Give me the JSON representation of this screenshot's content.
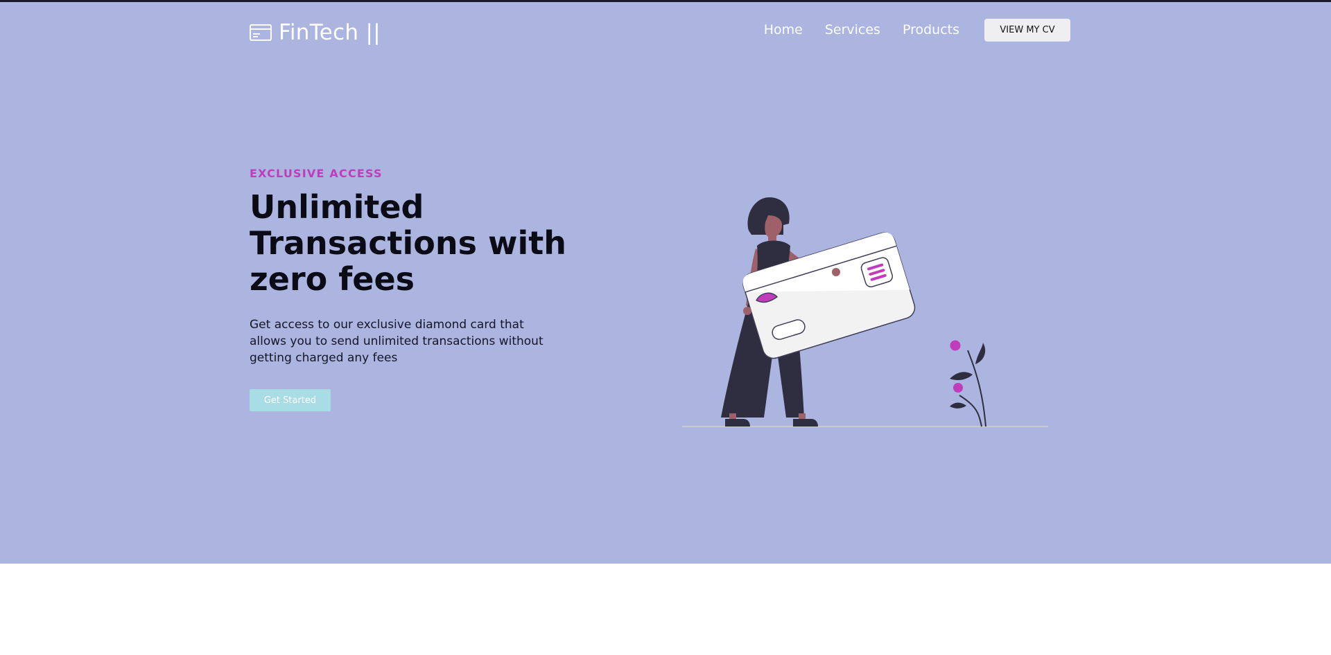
{
  "brand": {
    "name": "FinTech ||",
    "logo_icon": "credit-card-icon"
  },
  "nav": {
    "links": [
      "Home",
      "Services",
      "Products"
    ],
    "cv_button": "VIEW MY CV"
  },
  "hero": {
    "eyebrow": "EXCLUSIVE ACCESS",
    "headline": "Unlimited Transactions with zero fees",
    "description": "Get access to our exclusive diamond card that allows you to send unlimited transactions without getting charged any fees",
    "cta": "Get Started",
    "illustration": "woman-holding-credit-card-illustration"
  },
  "colors": {
    "hero_background": "#abb5e0",
    "accent": "#c03cbb",
    "cta_background": "#a9dde6",
    "text_dark": "#0b0b16"
  }
}
